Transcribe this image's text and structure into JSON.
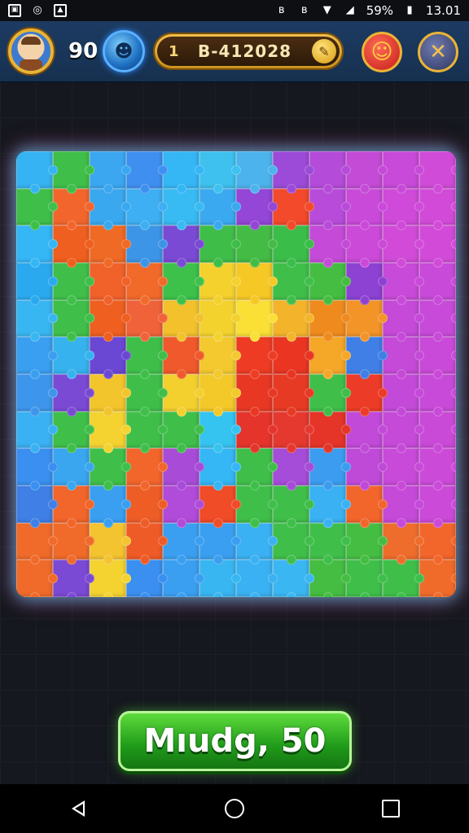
{
  "status_bar": {
    "left_icons": [
      "notification-icon",
      "whatsapp-icon",
      "gallery-icon"
    ],
    "right_icons": [
      "bluetooth-icon",
      "bluetooth-icon",
      "wifi-icon",
      "signal-icon"
    ],
    "battery_text": "59%",
    "time": "13.01"
  },
  "header": {
    "score": "90",
    "level_number": "1",
    "level_code": "B-412028",
    "avatar_icon": "player-avatar",
    "hint_icon": "hint-icon",
    "edit_icon": "pencil-icon",
    "emoji_icon": "emoji-icon",
    "close_icon": "close-icon",
    "accent_gold": "#e8b435",
    "accent_blue": "#1d3b63"
  },
  "board": {
    "rows": 12,
    "cols": 12,
    "colors": [
      [
        "#36b3f2",
        "#3fbf4a",
        "#3aa7f0",
        "#3f8ff0",
        "#35b6f5",
        "#3ec1ee",
        "#4db3ec",
        "#9b4bd8",
        "#b54bd9",
        "#c44bd6",
        "#c84ad8",
        "#d04bd8"
      ],
      [
        "#3fbf4a",
        "#f2662d",
        "#39a8ef",
        "#3daff2",
        "#38baf2",
        "#3ba9f0",
        "#9446d6",
        "#f24a2a",
        "#b84bd9",
        "#c94ad9",
        "#cf4ad8",
        "#d24bd8"
      ],
      [
        "#35b6f5",
        "#ef5f1f",
        "#ef6a25",
        "#3d95e8",
        "#7a4ad4",
        "#3fbd49",
        "#44bb45",
        "#3bbd4a",
        "#c44ad7",
        "#cb4ad8",
        "#d14bd8",
        "#d24bd8"
      ],
      [
        "#2aa9ef",
        "#3fbf4a",
        "#f1612a",
        "#f16a2a",
        "#3ec14b",
        "#f4d12d",
        "#f6c826",
        "#3fbf4a",
        "#45bd42",
        "#8d42d3",
        "#c84ad8",
        "#c74ad8"
      ],
      [
        "#38b6f1",
        "#3fbf4a",
        "#ef5f20",
        "#f0623a",
        "#f2c12c",
        "#f3d22e",
        "#fadf35",
        "#f3b42b",
        "#ef8b1e",
        "#f29428",
        "#c54ad8",
        "#c74ad8"
      ],
      [
        "#3a9ff0",
        "#36b3ef",
        "#6b48d4",
        "#3fbf4a",
        "#f0592b",
        "#f3c92f",
        "#ee3c24",
        "#e93522",
        "#f5a728",
        "#3f7fe6",
        "#c44ad7",
        "#c94ad8"
      ],
      [
        "#3e96ec",
        "#7b4ad5",
        "#f3c52c",
        "#3fbf4a",
        "#f4d02f",
        "#f3c92a",
        "#e83824",
        "#e73a24",
        "#3fbf4a",
        "#ec3b27",
        "#c34ad8",
        "#c84ad8"
      ],
      [
        "#3ab1f2",
        "#3fbf4a",
        "#f4d331",
        "#3fbf4a",
        "#3fbf4a",
        "#35c3f0",
        "#e5342b",
        "#e53930",
        "#e53428",
        "#c14ad8",
        "#c64ad8",
        "#ca4ad8"
      ],
      [
        "#3a8ff0",
        "#39a6ef",
        "#3fbf4a",
        "#f2652b",
        "#a84cd8",
        "#35b6f5",
        "#3fbf4a",
        "#a54cd8",
        "#3c9cef",
        "#c04ad8",
        "#c84ad8",
        "#cb4ad8"
      ],
      [
        "#3f7fe6",
        "#f2652b",
        "#3a9ff0",
        "#ef5d27",
        "#b14bd9",
        "#f04c27",
        "#3fbf4a",
        "#3fbf4a",
        "#3ab1f2",
        "#f2652b",
        "#c54ad8",
        "#cb4ad8"
      ],
      [
        "#f06a2a",
        "#f06a2a",
        "#f4c330",
        "#ef5b26",
        "#3a9ff0",
        "#3a9ff0",
        "#3ab1f2",
        "#3fbf4a",
        "#3fbf4a",
        "#45bd42",
        "#ef6d2c",
        "#f2652b"
      ],
      [
        "#f06a2a",
        "#7b4ad5",
        "#f4d331",
        "#3a8ff0",
        "#3a9ff0",
        "#38b6f1",
        "#3ab1f2",
        "#3ab7f2",
        "#45bd42",
        "#3fbf4a",
        "#3fbf4a",
        "#f06a2a"
      ]
    ]
  },
  "action_button": {
    "label": "Mıudg, 50",
    "color": "#1f9a1a"
  },
  "nav_bar": {
    "back_icon": "back-icon",
    "home_icon": "home-icon",
    "recents_icon": "recents-icon"
  }
}
